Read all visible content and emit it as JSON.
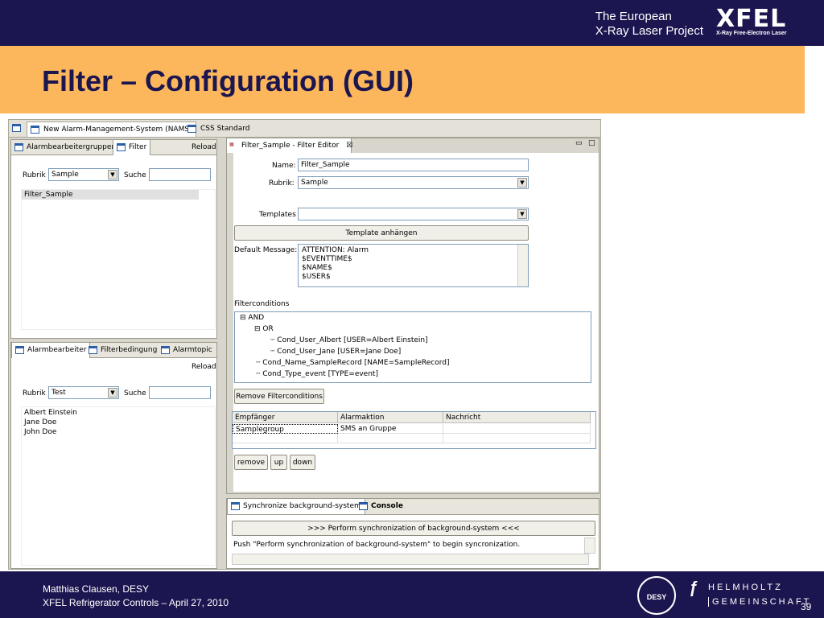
{
  "header": {
    "brand_line1": "The European",
    "brand_line2": "X-Ray Laser Project",
    "logo_big": "XFEL",
    "logo_small": "X-Ray Free-Electron Laser"
  },
  "slide": {
    "title": "Filter – Configuration (GUI)"
  },
  "footer": {
    "author": "Matthias Clausen, DESY",
    "event": "XFEL Refrigerator Controls – April 27, 2010",
    "page": "39",
    "desy": "DESY",
    "helm1": "HELMHOLTZ",
    "helm2": "GEMEINSCHAFT"
  },
  "app": {
    "perspective_tabs": [
      "New Alarm-Management-System (NAMS)",
      "CSS Standard"
    ],
    "top_view": {
      "tabs": [
        "Alarmbearbeitergruppen",
        "Filter"
      ],
      "reload": "Reload",
      "rubrik_label": "Rubrik",
      "rubrik_value": "Sample",
      "suche_label": "Suche",
      "suche_value": "",
      "items": [
        "Filter_Sample"
      ]
    },
    "bottom_view": {
      "tabs": [
        "Alarmbearbeiter",
        "Filterbedingung",
        "Alarmtopic"
      ],
      "reload": "Reload",
      "rubrik_label": "Rubrik",
      "rubrik_value": "Test",
      "suche_label": "Suche",
      "suche_value": "",
      "items": [
        "Albert Einstein",
        "Jane Doe",
        "John Doe"
      ]
    },
    "editor": {
      "tab": "Filter_Sample - Filter Editor",
      "name_label": "Name:",
      "name_value": "Filter_Sample",
      "rubrik_label": "Rubrik:",
      "rubrik_value": "Sample",
      "templates_label": "Templates",
      "templates_value": "",
      "template_button": "Template anhängen",
      "default_msg_label": "Default Message:",
      "default_msg_lines": [
        "ATTENTION: Alarm",
        "$EVENTTIME$",
        "$NAME$",
        "$USER$"
      ],
      "filterconditions_label": "Filterconditions",
      "tree": [
        "AND",
        "OR",
        "Cond_User_Albert    [USER=Albert Einstein]",
        "Cond_User_Jane    [USER=Jane Doe]",
        "Cond_Name_SampleRecord    [NAME=SampleRecord]",
        "Cond_Type_event    [TYPE=event]"
      ],
      "remove_fc_button": "Remove Filterconditions",
      "table_headers": [
        "Empfänger",
        "Alarmaktion",
        "Nachricht"
      ],
      "table_rows": [
        [
          "Samplegroup",
          "SMS an Gruppe",
          ""
        ]
      ],
      "btn_remove": "remove",
      "btn_up": "up",
      "btn_down": "down"
    },
    "console": {
      "tabs": [
        "Synchronize background-system",
        "Console"
      ],
      "button": ">>> Perform synchronization of background-system <<<",
      "message": "Push \"Perform synchronization of background-system\" to begin syncronization."
    }
  }
}
